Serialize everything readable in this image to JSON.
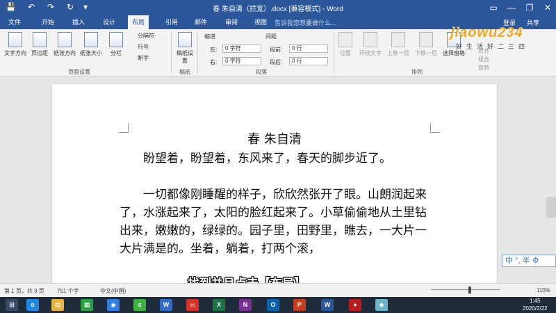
{
  "window": {
    "title": "春 朱自清（拦宽）.docx [兼容模式] - Word",
    "quick_access": [
      "💾",
      "↶",
      "↷",
      "↻",
      "▾"
    ],
    "controls": [
      "▭",
      "—",
      "❐",
      "✕"
    ]
  },
  "tabs": [
    "文件",
    "开始",
    "插入",
    "设计",
    "布局",
    "引用",
    "邮件",
    "审阅",
    "视图"
  ],
  "active_tab": "布局",
  "tell_me": "告诉我您想要做什么...",
  "login": "登录",
  "share": "共享",
  "ribbon": {
    "page_setup": {
      "buttons": [
        "文字方向",
        "页边距",
        "纸张方向",
        "纸张大小",
        "分栏"
      ],
      "small": [
        "分隔符·",
        "行号·",
        "断字·"
      ],
      "label": "页面设置"
    },
    "manuscript": {
      "button": "稿纸设置",
      "label": "稿纸"
    },
    "paragraph": {
      "indent_header": "缩进",
      "spacing_header": "间距",
      "left_label": "左:",
      "left_value": "0 字符",
      "right_label": "右:",
      "right_value": "0 字符",
      "before_label": "段前:",
      "before_value": "0 行",
      "after_label": "段后:",
      "after_value": "0 行",
      "label": "段落"
    },
    "arrange": {
      "buttons": [
        "位置",
        "环绕文字",
        "上移一层",
        "下移一层",
        "选择窗格"
      ],
      "small": [
        "对齐",
        "组合",
        "旋转"
      ],
      "label": "排列"
    }
  },
  "document": {
    "title": "春  朱自清",
    "paragraphs": [
      "　　盼望着，盼望着，东风来了，春天的脚步近了。",
      "　　一切都像刚睡醒的样子，欣欣然张开了眼。山朗润起来了，水涨起来了，太阳的脸红起来了。小草偷偷地从土里钻出来，嫩嫩的，绿绿的。园子里，田野里，瞧去，一大片一大片满是的。坐着，躺着，打两个滚，"
    ]
  },
  "caption": "找到并且点击【布局】",
  "status": {
    "page": "第 1 页，共 3 页",
    "words": "751 个字",
    "language": "中文(中国)",
    "zoom": "110%"
  },
  "taskbar": {
    "time": "1:45",
    "date": "2020/2/22",
    "icons": [
      {
        "name": "ie",
        "label": "e",
        "color": "#1e88e5"
      },
      {
        "name": "explorer",
        "label": "▤",
        "color": "#e3b341"
      },
      {
        "name": "store",
        "label": "▦",
        "color": "#2aa147"
      },
      {
        "name": "baidu",
        "label": "◉",
        "color": "#2f7de1"
      },
      {
        "name": "edge",
        "label": "e",
        "color": "#3cb53c"
      },
      {
        "name": "wps",
        "label": "W",
        "color": "#2f6cc8"
      },
      {
        "name": "chrome",
        "label": "◎",
        "color": "#d93025"
      },
      {
        "name": "excel",
        "label": "X",
        "color": "#1f7244"
      },
      {
        "name": "onenote",
        "label": "N",
        "color": "#7b2f91"
      },
      {
        "name": "outlook",
        "label": "O",
        "color": "#0a64ad"
      },
      {
        "name": "powerpoint",
        "label": "P",
        "color": "#c43e1c"
      },
      {
        "name": "word",
        "label": "W",
        "color": "#2b579a"
      },
      {
        "name": "record",
        "label": "●",
        "color": "#b81d1d"
      },
      {
        "name": "app",
        "label": "◆",
        "color": "#6cb5c9"
      }
    ]
  },
  "watermark": {
    "logo": "jiaowu234",
    "sub": "好生活好二三四"
  },
  "ime": "中 °, 半 ⚙"
}
